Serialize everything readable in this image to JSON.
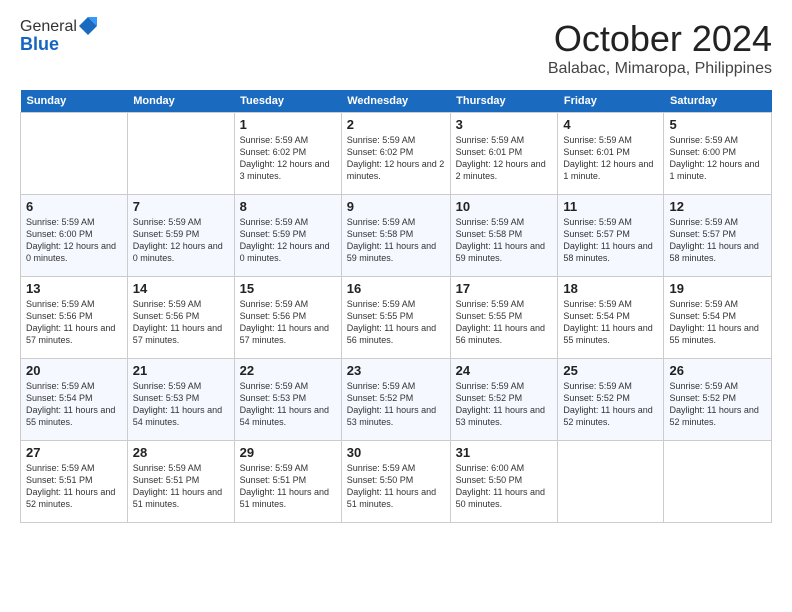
{
  "app": {
    "logo_line1": "General",
    "logo_line2": "Blue"
  },
  "header": {
    "title": "October 2024",
    "location": "Balabac, Mimaropa, Philippines"
  },
  "weekdays": [
    "Sunday",
    "Monday",
    "Tuesday",
    "Wednesday",
    "Thursday",
    "Friday",
    "Saturday"
  ],
  "weeks": [
    [
      {
        "day": "",
        "info": ""
      },
      {
        "day": "",
        "info": ""
      },
      {
        "day": "1",
        "info": "Sunrise: 5:59 AM\nSunset: 6:02 PM\nDaylight: 12 hours and 3 minutes."
      },
      {
        "day": "2",
        "info": "Sunrise: 5:59 AM\nSunset: 6:02 PM\nDaylight: 12 hours and 2 minutes."
      },
      {
        "day": "3",
        "info": "Sunrise: 5:59 AM\nSunset: 6:01 PM\nDaylight: 12 hours and 2 minutes."
      },
      {
        "day": "4",
        "info": "Sunrise: 5:59 AM\nSunset: 6:01 PM\nDaylight: 12 hours and 1 minute."
      },
      {
        "day": "5",
        "info": "Sunrise: 5:59 AM\nSunset: 6:00 PM\nDaylight: 12 hours and 1 minute."
      }
    ],
    [
      {
        "day": "6",
        "info": "Sunrise: 5:59 AM\nSunset: 6:00 PM\nDaylight: 12 hours and 0 minutes."
      },
      {
        "day": "7",
        "info": "Sunrise: 5:59 AM\nSunset: 5:59 PM\nDaylight: 12 hours and 0 minutes."
      },
      {
        "day": "8",
        "info": "Sunrise: 5:59 AM\nSunset: 5:59 PM\nDaylight: 12 hours and 0 minutes."
      },
      {
        "day": "9",
        "info": "Sunrise: 5:59 AM\nSunset: 5:58 PM\nDaylight: 11 hours and 59 minutes."
      },
      {
        "day": "10",
        "info": "Sunrise: 5:59 AM\nSunset: 5:58 PM\nDaylight: 11 hours and 59 minutes."
      },
      {
        "day": "11",
        "info": "Sunrise: 5:59 AM\nSunset: 5:57 PM\nDaylight: 11 hours and 58 minutes."
      },
      {
        "day": "12",
        "info": "Sunrise: 5:59 AM\nSunset: 5:57 PM\nDaylight: 11 hours and 58 minutes."
      }
    ],
    [
      {
        "day": "13",
        "info": "Sunrise: 5:59 AM\nSunset: 5:56 PM\nDaylight: 11 hours and 57 minutes."
      },
      {
        "day": "14",
        "info": "Sunrise: 5:59 AM\nSunset: 5:56 PM\nDaylight: 11 hours and 57 minutes."
      },
      {
        "day": "15",
        "info": "Sunrise: 5:59 AM\nSunset: 5:56 PM\nDaylight: 11 hours and 57 minutes."
      },
      {
        "day": "16",
        "info": "Sunrise: 5:59 AM\nSunset: 5:55 PM\nDaylight: 11 hours and 56 minutes."
      },
      {
        "day": "17",
        "info": "Sunrise: 5:59 AM\nSunset: 5:55 PM\nDaylight: 11 hours and 56 minutes."
      },
      {
        "day": "18",
        "info": "Sunrise: 5:59 AM\nSunset: 5:54 PM\nDaylight: 11 hours and 55 minutes."
      },
      {
        "day": "19",
        "info": "Sunrise: 5:59 AM\nSunset: 5:54 PM\nDaylight: 11 hours and 55 minutes."
      }
    ],
    [
      {
        "day": "20",
        "info": "Sunrise: 5:59 AM\nSunset: 5:54 PM\nDaylight: 11 hours and 55 minutes."
      },
      {
        "day": "21",
        "info": "Sunrise: 5:59 AM\nSunset: 5:53 PM\nDaylight: 11 hours and 54 minutes."
      },
      {
        "day": "22",
        "info": "Sunrise: 5:59 AM\nSunset: 5:53 PM\nDaylight: 11 hours and 54 minutes."
      },
      {
        "day": "23",
        "info": "Sunrise: 5:59 AM\nSunset: 5:52 PM\nDaylight: 11 hours and 53 minutes."
      },
      {
        "day": "24",
        "info": "Sunrise: 5:59 AM\nSunset: 5:52 PM\nDaylight: 11 hours and 53 minutes."
      },
      {
        "day": "25",
        "info": "Sunrise: 5:59 AM\nSunset: 5:52 PM\nDaylight: 11 hours and 52 minutes."
      },
      {
        "day": "26",
        "info": "Sunrise: 5:59 AM\nSunset: 5:52 PM\nDaylight: 11 hours and 52 minutes."
      }
    ],
    [
      {
        "day": "27",
        "info": "Sunrise: 5:59 AM\nSunset: 5:51 PM\nDaylight: 11 hours and 52 minutes."
      },
      {
        "day": "28",
        "info": "Sunrise: 5:59 AM\nSunset: 5:51 PM\nDaylight: 11 hours and 51 minutes."
      },
      {
        "day": "29",
        "info": "Sunrise: 5:59 AM\nSunset: 5:51 PM\nDaylight: 11 hours and 51 minutes."
      },
      {
        "day": "30",
        "info": "Sunrise: 5:59 AM\nSunset: 5:50 PM\nDaylight: 11 hours and 51 minutes."
      },
      {
        "day": "31",
        "info": "Sunrise: 6:00 AM\nSunset: 5:50 PM\nDaylight: 11 hours and 50 minutes."
      },
      {
        "day": "",
        "info": ""
      },
      {
        "day": "",
        "info": ""
      }
    ]
  ]
}
